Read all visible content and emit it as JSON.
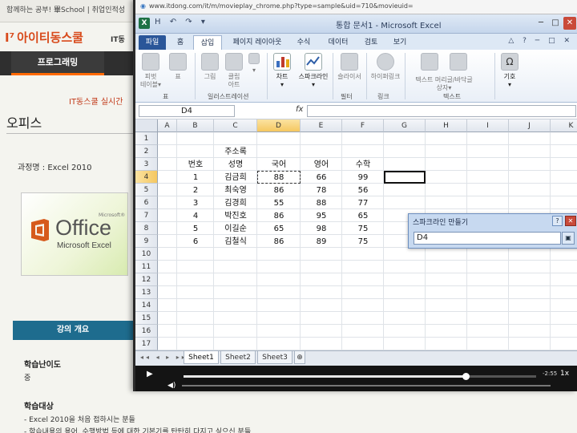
{
  "webpage": {
    "top_strip": "함께하는 공부! 畢School  |  취업인적성",
    "logo": "아이티동스쿨",
    "it_link": "IT동",
    "program_tab": "프로그래밍",
    "it_notice": "IT동스쿨 실시간",
    "office_title": "오피스",
    "course_label": "과정명 : Excel 2010",
    "thumbnail": {
      "word": "Office",
      "superscript": "Microsoft®",
      "subtitle": "Microsoft Excel"
    },
    "overview": "강의 개요",
    "difficulty_label": "학습난이도",
    "difficulty_value": "중",
    "target_label": "학습대상",
    "target_line1": "- Excel 2010을 처음 접하시는 분들",
    "target_line2": "- 학습내용의 용어, 수행방법 등에 대한 기본기를 탄탄히 다지고 싶으신 분들"
  },
  "player": {
    "url": "www.itdong.com/it/m/movieplay_chrome.php?type=sample&uid=710&movieuid=",
    "progress_fraction": 0.8,
    "time_remaining": "-2:55",
    "speed": "1x"
  },
  "excel": {
    "window_title": "통합 문서1 - Microsoft Excel",
    "quick_access": "H ↶ ↷ ▾",
    "tabs": [
      "파일",
      "홈",
      "삽입",
      "페이지 레이아웃",
      "수식",
      "데이터",
      "검토",
      "보기"
    ],
    "active_tab": "삽입",
    "ribbon_controls": "△ ? ─ □ ✕",
    "ribbon": {
      "pivot": "피벗\n테이블▾",
      "table": "표",
      "picture": "그림",
      "clipart": "클립\n아트",
      "shapes": "▾",
      "chart": "차트\n▾",
      "sparkline": "스파크라인\n▾",
      "slicer": "슬라이서",
      "hyperlink": "하이퍼링크",
      "textbox": "텍스트 머리글/바닥글\n상자▾",
      "symbol": "기호\n▾",
      "group_table": "표",
      "group_illust": "일러스트레이션",
      "group_filter": "필터",
      "group_link": "링크",
      "group_text": "텍스트"
    },
    "namebox": "D4",
    "fx": "fx",
    "columns": [
      "A",
      "B",
      "C",
      "D",
      "E",
      "F",
      "G",
      "H",
      "I",
      "J",
      "K"
    ],
    "rows": [
      "1",
      "2",
      "3",
      "4",
      "5",
      "6",
      "7",
      "8",
      "9",
      "10",
      "11",
      "12",
      "13",
      "14",
      "15",
      "16",
      "17"
    ],
    "sheet_title": "주소록",
    "table_headers": [
      "번호",
      "성명",
      "국어",
      "영어",
      "수학"
    ],
    "table_rows": [
      [
        "1",
        "김금희",
        "88",
        "66",
        "99"
      ],
      [
        "2",
        "최숙영",
        "86",
        "78",
        "56"
      ],
      [
        "3",
        "김경희",
        "55",
        "88",
        "77"
      ],
      [
        "4",
        "박진호",
        "86",
        "95",
        "65"
      ],
      [
        "5",
        "이길순",
        "65",
        "98",
        "75"
      ],
      [
        "6",
        "김철식",
        "86",
        "89",
        "75"
      ]
    ],
    "sheet_tabs": [
      "Sheet1",
      "Sheet2",
      "Sheet3"
    ],
    "sheet_nav": "◂◂ ◂ ▸ ▸▸",
    "dialog": {
      "title": "스파크라인 만들기",
      "input_value": "D4",
      "help": "?",
      "close": "✕",
      "collapse": "▣"
    }
  },
  "colors": {
    "excel_green": "#1e7145",
    "selection_header": "#f5c760",
    "file_tab": "#2a5699",
    "overview_bar": "#1e6c8e"
  },
  "icons": [
    "globe-icon",
    "excel-logo-icon",
    "pivot-table-icon",
    "table-icon",
    "picture-icon",
    "clipart-icon",
    "chart-icon",
    "sparkline-icon",
    "slicer-icon",
    "hyperlink-icon",
    "textbox-icon",
    "header-footer-icon",
    "symbol-icon",
    "play-icon",
    "volume-icon"
  ]
}
